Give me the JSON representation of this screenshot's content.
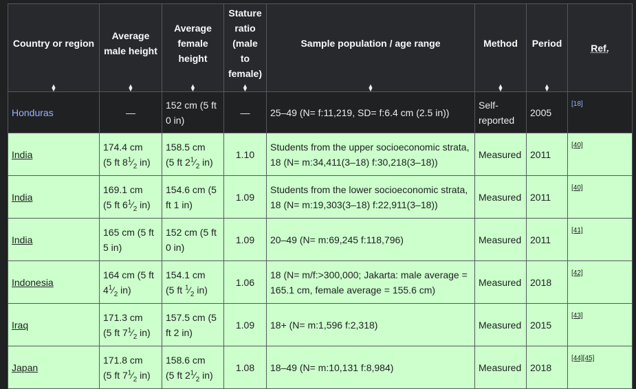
{
  "headers": {
    "country": "Country or region",
    "male": "Average male height",
    "female": "Average female height",
    "ratio": "Stature ratio (male to female)",
    "sample": "Sample population / age range",
    "method": "Method",
    "period": "Period",
    "ref": "Ref."
  },
  "sort_glyph": "▲▼",
  "rows": [
    {
      "country": "Honduras",
      "male": "—",
      "female": "152 cm (5 ft 0 in)",
      "ratio": "—",
      "sample": "25–49 (N= f:11,219, SD= f:6.4 cm (2.5 in))",
      "method": "Self-reported",
      "period": "2005",
      "ref": "[18]"
    },
    {
      "country": "India",
      "male_a": "174.4 cm",
      "male_b": "(5 ft 8",
      "male_f": "1/2",
      "male_c": " in)",
      "female_a": "158.5 cm",
      "female_b": "(5 ft 2",
      "female_f": "1/2",
      "female_c": " in)",
      "ratio": "1.10",
      "sample": "Students from the upper socioeconomic strata, 18 (N= m:34,411(3–18) f:30,218(3–18))",
      "method": "Measured",
      "period": "2011",
      "ref": "[40]"
    },
    {
      "country": "India",
      "male_a": "169.1 cm",
      "male_b": "(5 ft 6",
      "male_f": "1/2",
      "male_c": " in)",
      "female": "154.6 cm (5 ft 1 in)",
      "ratio": "1.09",
      "sample": "Students from the lower socioeconomic strata, 18 (N= m:19,303(3–18) f:22,911(3–18))",
      "method": "Measured",
      "period": "2011",
      "ref": "[40]"
    },
    {
      "country": "India",
      "male": "165 cm (5 ft 5 in)",
      "female": "152 cm (5 ft 0 in)",
      "ratio": "1.09",
      "sample": "20–49 (N= m:69,245 f:118,796)",
      "method": "Measured",
      "period": "2011",
      "ref": "[41]"
    },
    {
      "country": "Indonesia",
      "male_a": "164 cm (5 ft",
      "male_b": "4",
      "male_f": "1/2",
      "male_c": " in)",
      "female_a": "154.1 cm",
      "female_b": "(5 ft ",
      "female_f": "1/2",
      "female_c": " in)",
      "ratio": "1.06",
      "sample": "18 (N= m/f:>300,000; Jakarta: male average = 165.1 cm, female average = 155.6 cm)",
      "method": "Measured",
      "period": "2018",
      "ref": "[42]"
    },
    {
      "country": "Iraq",
      "male_a": "171.3 cm",
      "male_b": "(5 ft 7",
      "male_f": "1/2",
      "male_c": " in)",
      "female": "157.5 cm (5 ft 2 in)",
      "ratio": "1.09",
      "sample": "18+ (N= m:1,596 f:2,318)",
      "method": "Measured",
      "period": "2015",
      "ref": "[43]"
    },
    {
      "country": "Japan",
      "male_a": "171.8 cm",
      "male_b": "(5 ft 7",
      "male_f": "1/2",
      "male_c": " in)",
      "female_a": "158.6 cm",
      "female_b": "(5 ft 2",
      "female_f": "1/2",
      "female_c": " in)",
      "ratio": "1.08",
      "sample": "18–49 (N= m:10,131 f:8,984)",
      "method": "Measured",
      "period": "2018",
      "ref": "[44][45]"
    }
  ]
}
